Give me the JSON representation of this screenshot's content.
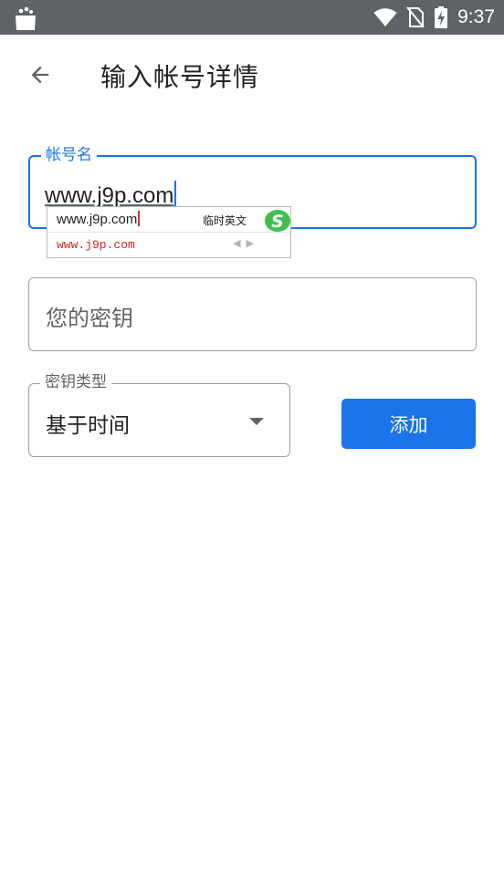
{
  "status_bar": {
    "time": "9:37"
  },
  "header": {
    "title": "输入帐号详情"
  },
  "account_field": {
    "label": "帐号名",
    "value": "www.j9p.com"
  },
  "ime_panel": {
    "composition": "www.j9p.com",
    "mode_label": "临时英文",
    "candidate": "www.j9p.com",
    "logo_letter": "S"
  },
  "key_field": {
    "placeholder": "您的密钥"
  },
  "key_type": {
    "label": "密钥类型",
    "selected": "基于时间"
  },
  "add_button": {
    "label": "添加"
  },
  "colors": {
    "accent": "#1a73e8",
    "status_bar": "#5f6368",
    "border": "#9aa0a6",
    "candidate_red": "#c62828"
  }
}
